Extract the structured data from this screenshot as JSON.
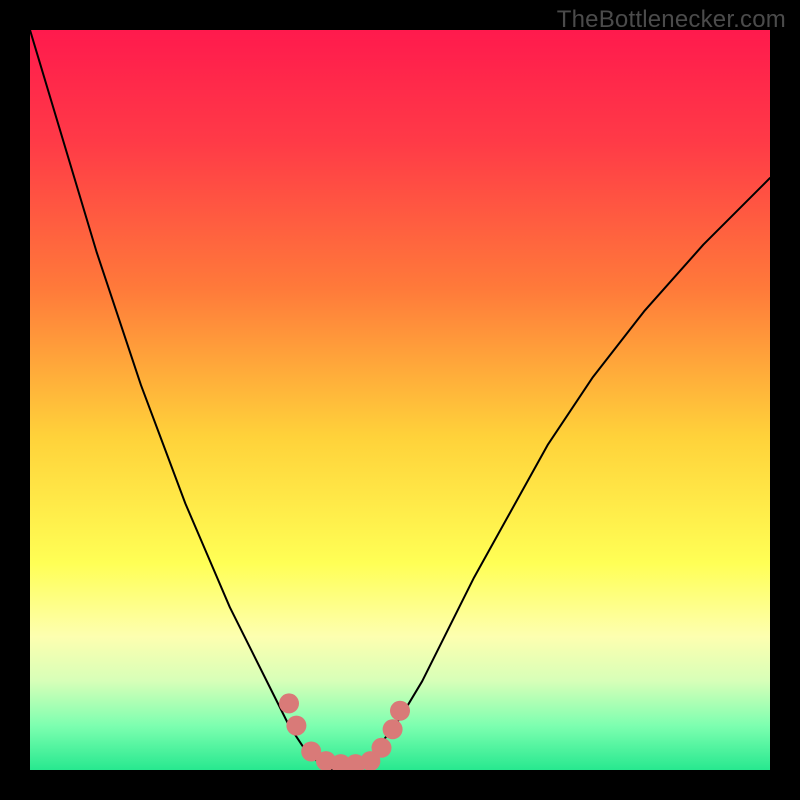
{
  "watermark": "TheBottlenecker.com",
  "chart_data": {
    "type": "line",
    "title": "",
    "xlabel": "",
    "ylabel": "",
    "xlim": [
      0,
      100
    ],
    "ylim": [
      0,
      100
    ],
    "background_gradient": {
      "stops": [
        {
          "offset": 0.0,
          "color": "#ff1a4d"
        },
        {
          "offset": 0.15,
          "color": "#ff3a47"
        },
        {
          "offset": 0.35,
          "color": "#ff7a3a"
        },
        {
          "offset": 0.55,
          "color": "#ffd23a"
        },
        {
          "offset": 0.72,
          "color": "#ffff55"
        },
        {
          "offset": 0.82,
          "color": "#fdffb0"
        },
        {
          "offset": 0.88,
          "color": "#d7ffb8"
        },
        {
          "offset": 0.94,
          "color": "#7dffb0"
        },
        {
          "offset": 1.0,
          "color": "#27e88f"
        }
      ]
    },
    "series": [
      {
        "name": "bottleneck-curve",
        "color": "#000000",
        "stroke_width": 2,
        "x": [
          0,
          3,
          6,
          9,
          12,
          15,
          18,
          21,
          24,
          27,
          30,
          33,
          35,
          37,
          39,
          41,
          43,
          45,
          47,
          50,
          53,
          56,
          60,
          65,
          70,
          76,
          83,
          91,
          100
        ],
        "y": [
          100,
          90,
          80,
          70,
          61,
          52,
          44,
          36,
          29,
          22,
          16,
          10,
          6,
          3,
          1,
          0,
          0,
          1,
          3,
          7,
          12,
          18,
          26,
          35,
          44,
          53,
          62,
          71,
          80
        ]
      }
    ],
    "markers": {
      "name": "data-points",
      "color": "#d97a78",
      "radius": 10,
      "points": [
        {
          "x": 35.0,
          "y": 9.0
        },
        {
          "x": 36.0,
          "y": 6.0
        },
        {
          "x": 38.0,
          "y": 2.5
        },
        {
          "x": 40.0,
          "y": 1.2
        },
        {
          "x": 42.0,
          "y": 0.8
        },
        {
          "x": 44.0,
          "y": 0.8
        },
        {
          "x": 46.0,
          "y": 1.2
        },
        {
          "x": 47.5,
          "y": 3.0
        },
        {
          "x": 49.0,
          "y": 5.5
        },
        {
          "x": 50.0,
          "y": 8.0
        }
      ]
    }
  }
}
